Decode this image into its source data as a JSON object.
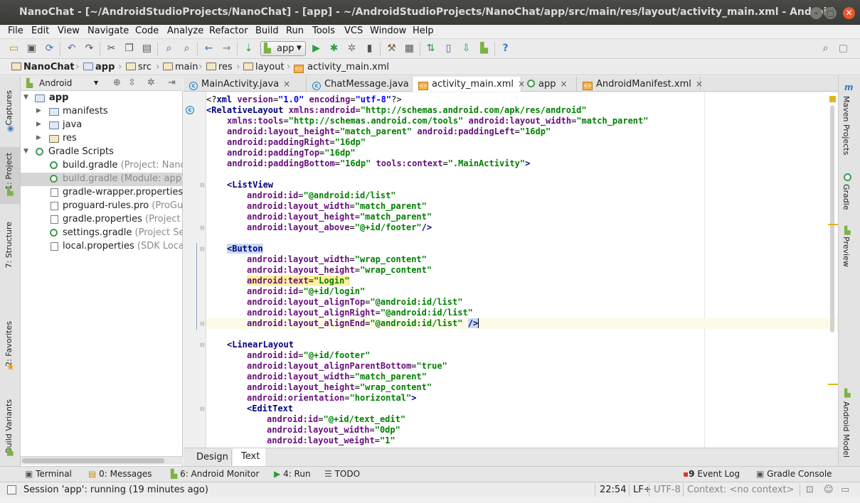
{
  "window": {
    "title": "NanoChat - [~/AndroidStudioProjects/NanoChat] - [app] - ~/AndroidStudioProjects/NanoChat/app/src/main/res/layout/activity_main.xml - Android"
  },
  "menu": [
    "File",
    "Edit",
    "View",
    "Navigate",
    "Code",
    "Analyze",
    "Refactor",
    "Build",
    "Run",
    "Tools",
    "VCS",
    "Window",
    "Help"
  ],
  "toolbar": {
    "run_config": "app"
  },
  "breadcrumb": [
    "NanoChat",
    "app",
    "src",
    "main",
    "res",
    "layout",
    "activity_main.xml"
  ],
  "left_tabs": [
    "Captures",
    "1: Project",
    "7: Structure",
    "2: Favorites",
    "Build Variants"
  ],
  "project_panel": {
    "view": "Android",
    "tree": [
      {
        "label": "app",
        "sub": ""
      },
      {
        "label": "manifests",
        "sub": ""
      },
      {
        "label": "java",
        "sub": ""
      },
      {
        "label": "res",
        "sub": ""
      },
      {
        "label": "Gradle Scripts",
        "sub": ""
      },
      {
        "label": "build.gradle",
        "sub": "(Project: Nano"
      },
      {
        "label": "build.gradle",
        "sub": "(Module: app)"
      },
      {
        "label": "gradle-wrapper.properties",
        "sub": ""
      },
      {
        "label": "proguard-rules.pro",
        "sub": "(ProGua"
      },
      {
        "label": "gradle.properties",
        "sub": "(Project P"
      },
      {
        "label": "settings.gradle",
        "sub": "(Project Se"
      },
      {
        "label": "local.properties",
        "sub": "(SDK Locat"
      }
    ]
  },
  "editor_tabs": [
    "MainActivity.java",
    "ChatMessage.java",
    "activity_main.xml",
    "app",
    "AndroidManifest.xml"
  ],
  "code": {
    "l1": {
      "a": "<?",
      "b": "xml ",
      "c": "version",
      "d": "=",
      "e": "\"1.0\"",
      "f": " encoding",
      "g": "=",
      "h": "\"utf-8\"",
      "i": "?>"
    },
    "l2": {
      "t": "<RelativeLayout ",
      "n": "xmlns:android",
      "v": "\"http://schemas.android.com/apk/res/android\""
    },
    "l3": {
      "n1": "xmlns:tools",
      "v1": "\"http://schemas.android.com/tools\"",
      "n2": "android:layout_width",
      "v2": "\"match_parent\""
    },
    "l4": {
      "n1": "android:layout_height",
      "v1": "\"match_parent\"",
      "n2": "android:paddingLeft",
      "v2": "\"16dp\""
    },
    "l5": {
      "n": "android:paddingRight",
      "v": "\"16dp\""
    },
    "l6": {
      "n": "android:paddingTop",
      "v": "\"16dp\""
    },
    "l7": {
      "n1": "android:paddingBottom",
      "v1": "\"16dp\"",
      "n2": "tools:context",
      "v2": "\".MainActivity\"",
      "e": ">"
    },
    "l9": {
      "t": "<ListView"
    },
    "l10": {
      "n": "android:id",
      "v": "\"@android:id/list\""
    },
    "l11": {
      "n": "android:layout_width",
      "v": "\"match_parent\""
    },
    "l12": {
      "n": "android:layout_height",
      "v": "\"match_parent\""
    },
    "l13": {
      "n": "android:layout_above",
      "v": "\"@+id/footer\"",
      "e": "/>"
    },
    "l15": {
      "t": "<Button"
    },
    "l16": {
      "n": "android:layout_width",
      "v": "\"wrap_content\""
    },
    "l17": {
      "n": "android:layout_height",
      "v": "\"wrap_content\""
    },
    "l18": {
      "n": "android:text",
      "v": "\"Login\""
    },
    "l19": {
      "n": "android:id",
      "v": "\"@+id/login\""
    },
    "l20": {
      "n": "android:layout_alignTop",
      "v": "\"@android:id/list\""
    },
    "l21": {
      "n": "android:layout_alignRight",
      "v": "\"@android:id/list\""
    },
    "l22": {
      "n": "android:layout_alignEnd",
      "v": "\"@android:id/list\"",
      "e": "/>"
    },
    "l24": {
      "t": "<LinearLayout"
    },
    "l25": {
      "n": "android:id",
      "v": "\"@+id/footer\""
    },
    "l26": {
      "n": "android:layout_alignParentBottom",
      "v": "\"true\""
    },
    "l27": {
      "n": "android:layout_width",
      "v": "\"match_parent\""
    },
    "l28": {
      "n": "android:layout_height",
      "v": "\"wrap_content\""
    },
    "l29": {
      "n": "android:orientation",
      "v": "\"horizontal\"",
      "e": ">"
    },
    "l30": {
      "t": "<EditText"
    },
    "l31": {
      "n": "android:id",
      "v": "\"@+id/text_edit\""
    },
    "l32": {
      "n": "android:layout_width",
      "v": "\"0dp\""
    },
    "l33": {
      "n": "android:layout_weight",
      "v": "\"1\""
    }
  },
  "design_tabs": [
    "Design",
    "Text"
  ],
  "right_tabs": [
    "Maven Projects",
    "Gradle",
    "Preview",
    "Android Model"
  ],
  "bottom_tools": {
    "terminal": "Terminal",
    "messages": "0: Messages",
    "monitor": "6: Android Monitor",
    "run": "4: Run",
    "todo": "TODO",
    "event_log": "Event Log",
    "event_count": "9",
    "gradle_console": "Gradle Console"
  },
  "status": {
    "message": "Session 'app': running (19 minutes ago)",
    "position": "22:54",
    "line_sep": "LF÷",
    "encoding": "UTF-8",
    "context": "Context: <no context>"
  },
  "colors": {
    "tag": "#000080",
    "attr": "#660e7a",
    "value": "#008000",
    "title_bg": "#3c3b37",
    "close_btn": "#e8572c"
  }
}
